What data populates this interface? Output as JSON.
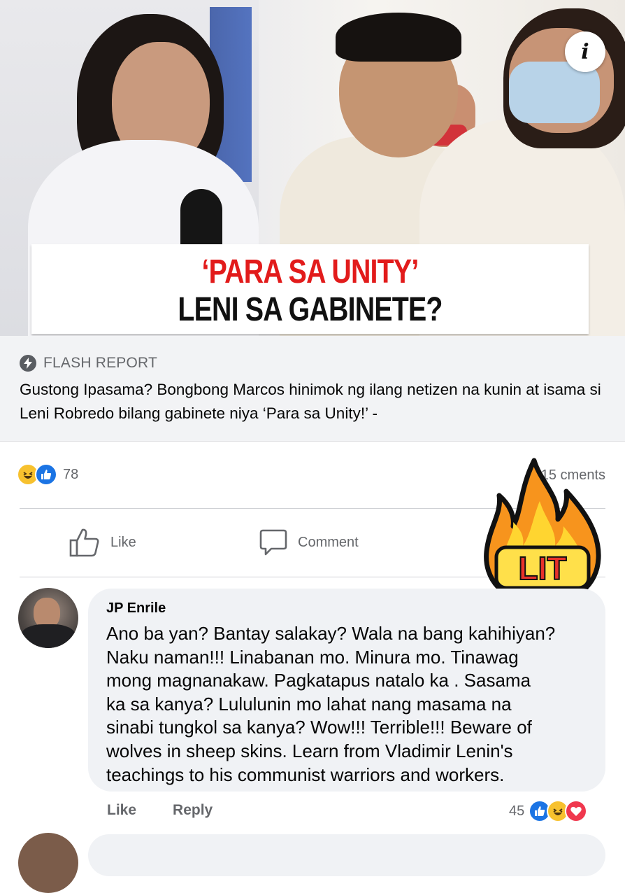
{
  "hero": {
    "headline_line1": "‘PARA SA UNITY’",
    "headline_line2": "LENI SA GABINETE?",
    "info_icon": "info-icon"
  },
  "link_preview": {
    "source_icon": "lightning-bolt-icon",
    "source": "FLASH REPORT",
    "title": "Gustong Ipasama? Bongbong Marcos hinimok ng ilang netizen na kunin at isama si Leni Robredo bilang gabinete niya ‘Para sa Unity!’ -"
  },
  "reactions": {
    "icons": [
      "haha-icon",
      "like-icon"
    ],
    "count": "78",
    "comments_prefix": "1",
    "comments_mid": "5 c",
    "comments_suffix": "ments"
  },
  "actions": {
    "like": "Like",
    "comment": "Comment"
  },
  "sticker": {
    "label": "LIT",
    "flame_color": "#f7941d",
    "text_color": "#e8322b"
  },
  "comment": {
    "author": "JP Enrile",
    "text": "Ano ba yan? Bantay salakay? Wala na bang kahihiyan?\nNaku naman!!! Linabanan mo. Minura mo. Tinawag\nmong magnanakaw. Pagkatapus natalo ka . Sasama\nka sa kanya? Lululunin mo lahat nang masama na\nsinabi tungkol sa kanya? Wow!!! Terrible!!! Beware of\nwolves in sheep skins. Learn from Vladimir Lenin's\nteachings to his communist warriors and workers.",
    "like": "Like",
    "reply": "Reply",
    "reaction_count": "45",
    "reaction_icons": [
      "like-icon",
      "haha-icon",
      "love-icon"
    ]
  },
  "colors": {
    "accent_blue": "#1b74e4",
    "headline_red": "#e21b1b",
    "muted_text": "#65676b",
    "bubble_bg": "#f0f2f5"
  }
}
